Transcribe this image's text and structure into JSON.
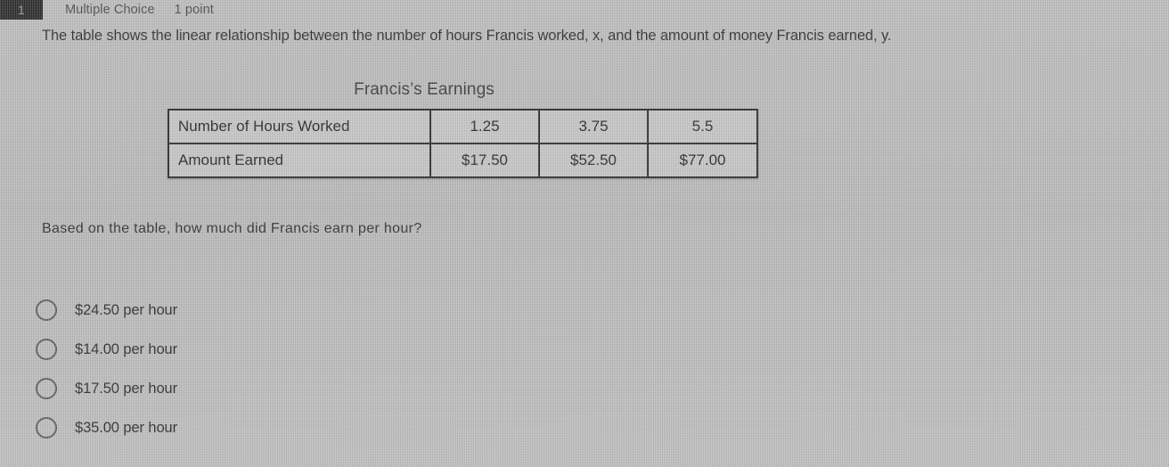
{
  "header": {
    "question_number": "1",
    "question_type": "Multiple Choice",
    "points": "1 point"
  },
  "question": {
    "stem": "The table shows the linear relationship between the number of hours Francis worked, x, and the amount of money Francis earned, y.",
    "prompt": "Based on the table, how much did Francis earn per hour?"
  },
  "table": {
    "title": "Francis’s Earnings",
    "rows": [
      {
        "label": "Number of Hours Worked",
        "values": [
          "1.25",
          "3.75",
          "5.5"
        ]
      },
      {
        "label": "Amount Earned",
        "values": [
          "$17.50",
          "$52.50",
          "$77.00"
        ]
      }
    ]
  },
  "choices": [
    {
      "label": "$24.50 per hour",
      "selected": false
    },
    {
      "label": "$14.00 per hour",
      "selected": false
    },
    {
      "label": "$17.50 per hour",
      "selected": false
    },
    {
      "label": "$35.00 per hour",
      "selected": false
    }
  ],
  "colors": {
    "background": "#b9b9b9",
    "badge_background": "#2b2b2b",
    "badge_text": "#9a9a9a",
    "table_border": "#2a2a2a",
    "body_text": "#2e2e2e"
  }
}
